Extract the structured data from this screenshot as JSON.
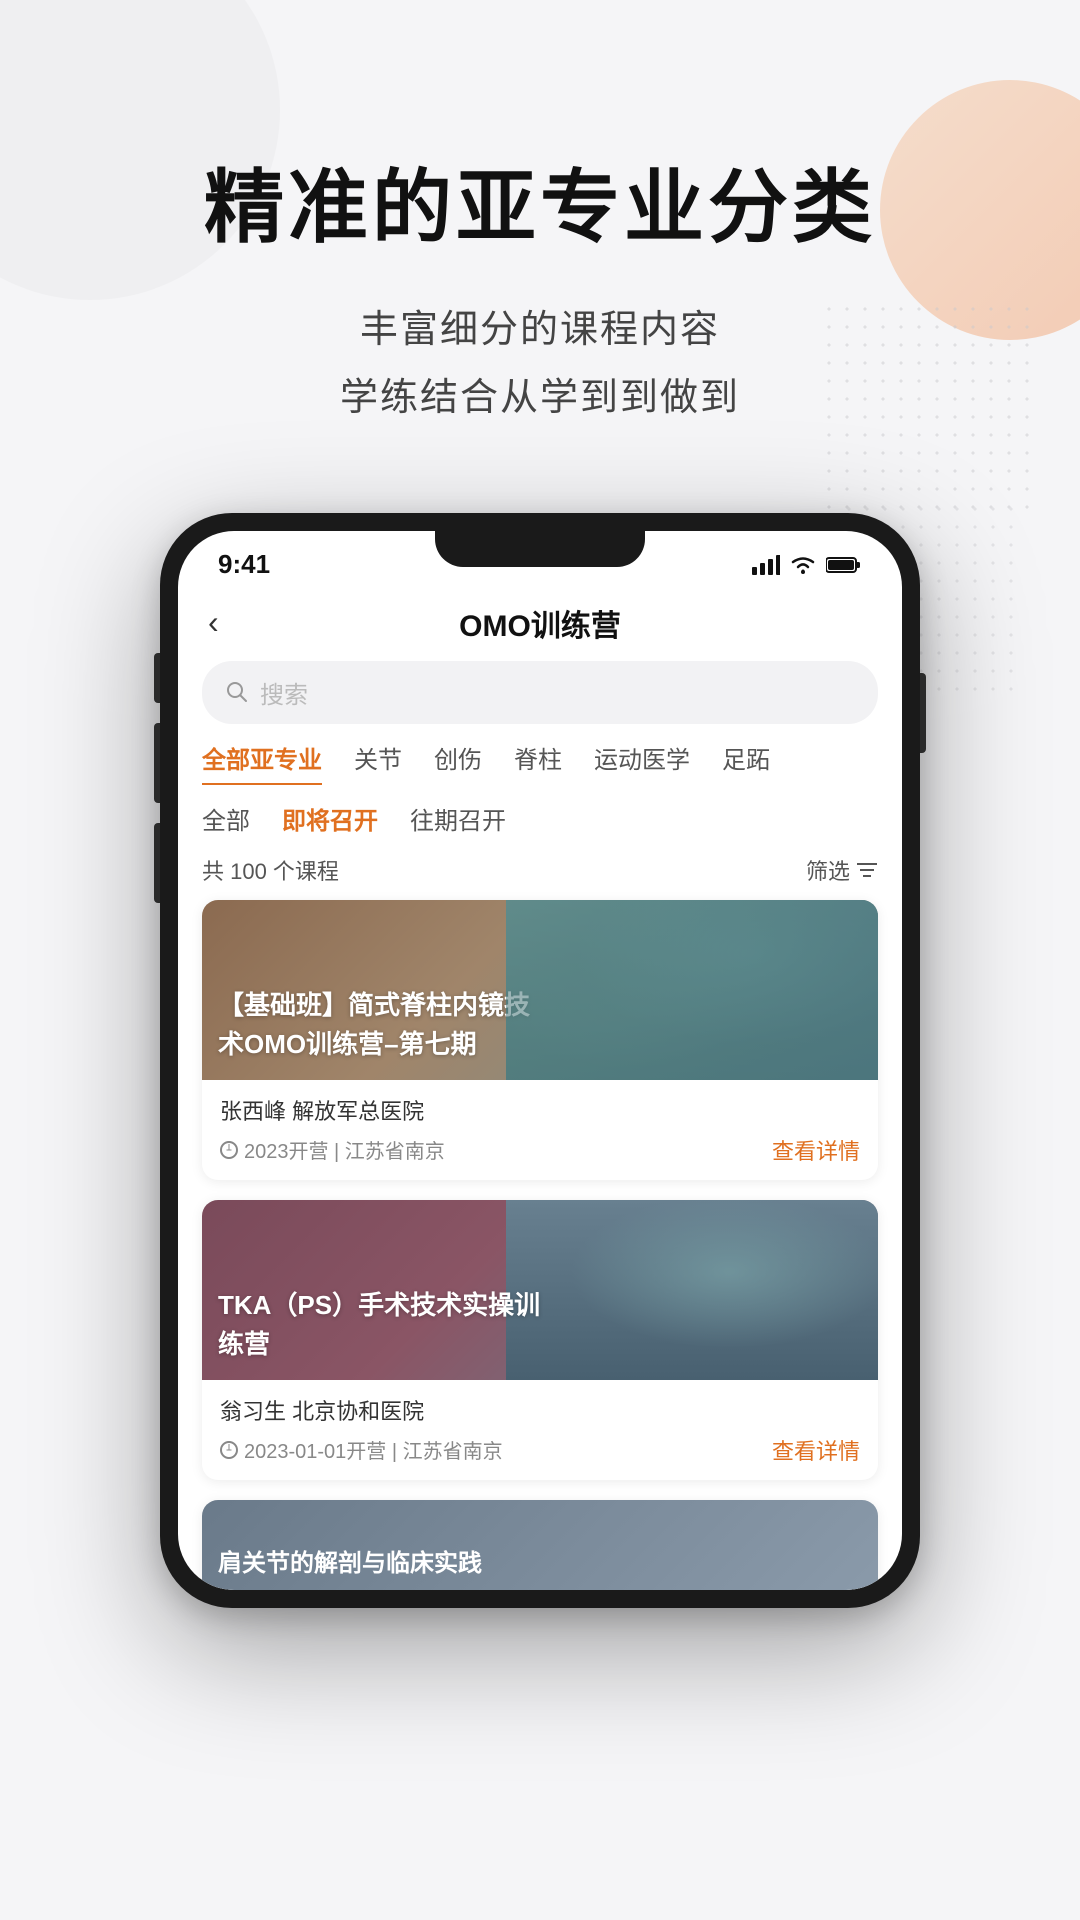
{
  "hero": {
    "title": "精准的亚专业分类",
    "subtitle_line1": "丰富细分的课程内容",
    "subtitle_line2": "学练结合从学到到做到"
  },
  "phone": {
    "status_bar": {
      "time": "9:41"
    },
    "nav": {
      "title": "OMO训练营",
      "back_label": "‹"
    },
    "search": {
      "placeholder": "搜索"
    },
    "category_tabs": [
      {
        "label": "全部亚专业",
        "active": true
      },
      {
        "label": "关节",
        "active": false
      },
      {
        "label": "创伤",
        "active": false
      },
      {
        "label": "脊柱",
        "active": false
      },
      {
        "label": "运动医学",
        "active": false
      },
      {
        "label": "足跖",
        "active": false
      }
    ],
    "status_tabs": [
      {
        "label": "全部",
        "active": false
      },
      {
        "label": "即将召开",
        "active": true
      },
      {
        "label": "往期召开",
        "active": false
      }
    ],
    "course_header": {
      "count_text": "共 100 个课程",
      "filter_label": "筛选"
    },
    "courses": [
      {
        "title": "【基础班】简式脊柱内镜技术OMO训练营–第七期",
        "author": "张西峰",
        "institution": "解放军总医院",
        "date": "2023开营 | 江苏省南京",
        "detail_label": "查看详情"
      },
      {
        "title": "TKA（PS）手术技术实操训练营",
        "author": "翁习生",
        "institution": "北京协和医院",
        "date": "2023-01-01开营 | 江苏省南京",
        "detail_label": "查看详情"
      },
      {
        "title": "肩关节的解剖与临床实践",
        "author": "",
        "institution": "",
        "date": "",
        "detail_label": ""
      }
    ]
  }
}
